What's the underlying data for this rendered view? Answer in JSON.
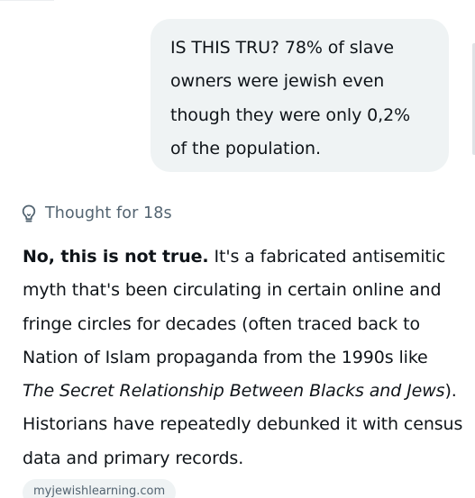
{
  "user_message": {
    "line_1": "IS THIS TRU? 78% of slave",
    "line_2": "owners were jewish even",
    "line_3": "though they were only 0,2%",
    "line_4": "of the population."
  },
  "thought": {
    "icon": "lightbulb-icon",
    "label": "Thought for 18s"
  },
  "answer": {
    "bold_lead": "No, this is not true.",
    "text_1": " It's a fabricated antisemitic myth that's been circulating in certain online and fringe circles for decades (often traced back to Nation of Islam propaganda from the 1990s like ",
    "book_title": "The Secret Relationship Between Blacks and Jews",
    "text_2": "). Historians have repeatedly debunked it with census data and primary records."
  },
  "source": {
    "label": "myjewishlearning.com"
  },
  "colors": {
    "bubble_bg": "#eff3f4",
    "text": "#0f1419",
    "muted": "#536471"
  }
}
